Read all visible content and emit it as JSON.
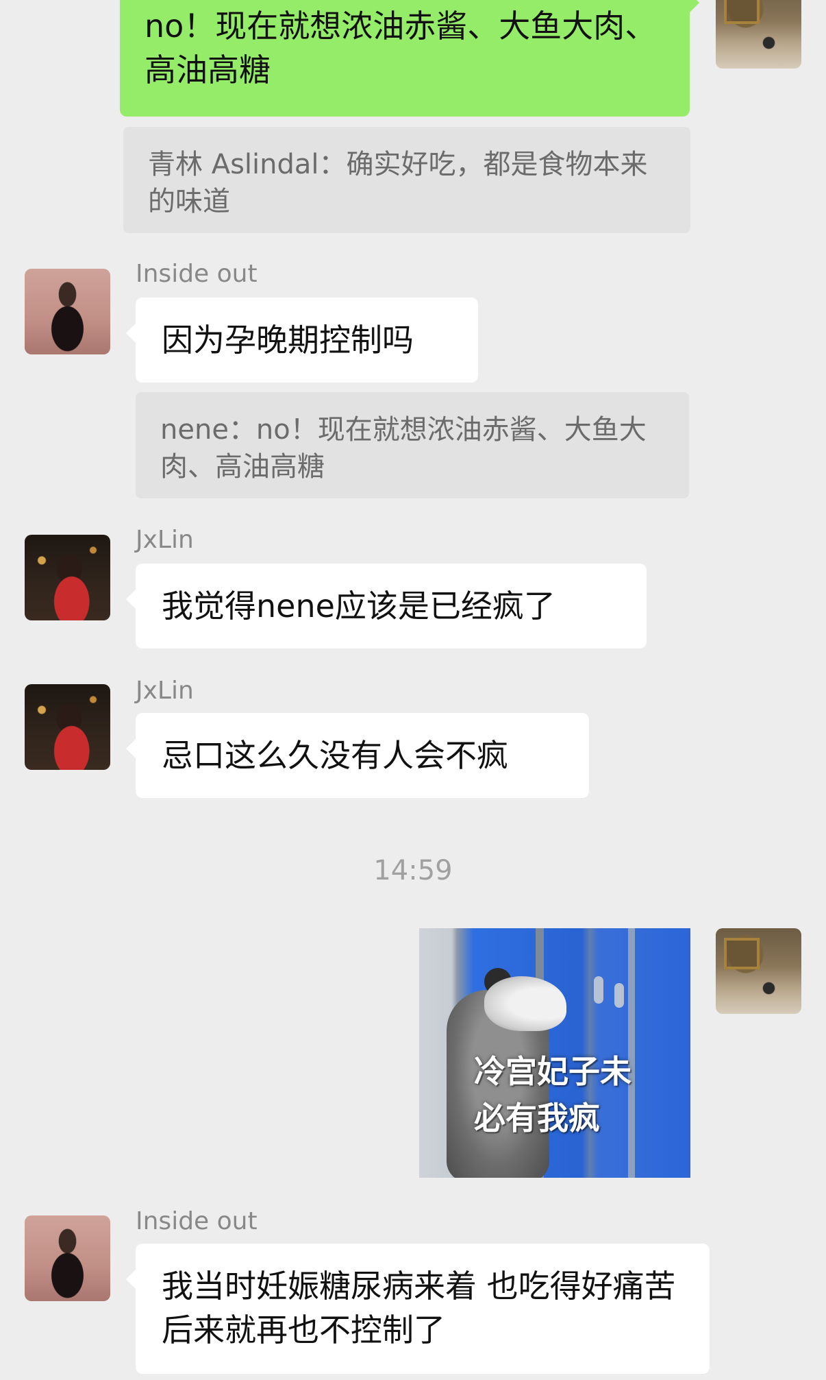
{
  "messages": [
    {
      "sender": "me",
      "text": "no！现在就想浓油赤酱、大鱼大肉、高油高糖"
    },
    {
      "quote": "青林 Aslindal：确实好吃，都是食物本来的味道"
    },
    {
      "sender": "Inside out",
      "text": "因为孕晚期控制吗"
    },
    {
      "quote": "nene：no！现在就想浓油赤酱、大鱼大肉、高油高糖"
    },
    {
      "sender": "JxLin",
      "text": "我觉得nene应该是已经疯了"
    },
    {
      "sender": "JxLin",
      "text": "忌口这么久没有人会不疯"
    },
    {
      "timestamp": "14:59"
    },
    {
      "sender": "me",
      "sticker_caption": "冷宫妃子未必有我疯"
    },
    {
      "sender": "Inside out",
      "text": "我当时妊娠糖尿病来着 也吃得好痛苦 后来就再也不控制了"
    }
  ],
  "colors": {
    "background": "#ededed",
    "bubble_self": "#95ec69",
    "bubble_other": "#ffffff",
    "quote": "#e2e2e2"
  },
  "icons": [
    "avatar-me",
    "avatar-insideout",
    "avatar-jxlin",
    "opossum-sticker"
  ]
}
